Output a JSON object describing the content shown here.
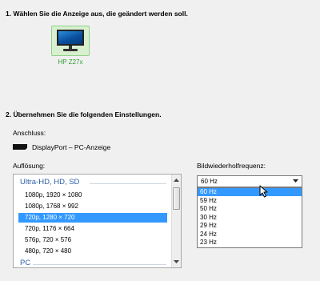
{
  "section1": {
    "heading": "1. Wählen Sie die Anzeige aus, die geändert werden soll."
  },
  "monitor": {
    "label": "HP Z27x",
    "icon": "monitor-icon"
  },
  "section2": {
    "heading": "2. Übernehmen Sie die folgenden Einstellungen."
  },
  "connection": {
    "label": "Anschluss:",
    "value": "DisplayPort – PC-Anzeige",
    "icon": "displayport-icon"
  },
  "resolution": {
    "label": "Auflösung:",
    "groups": [
      {
        "name": "Ultra-HD, HD, SD"
      },
      {
        "name": "PC"
      }
    ],
    "items": [
      "1080p, 1920 × 1080",
      "1080p, 1768 × 992",
      "720p, 1280 × 720",
      "720p, 1176 × 664",
      "576p, 720 × 576",
      "480p, 720 × 480"
    ],
    "selected_index": 2
  },
  "refresh": {
    "label": "Bildwiederholfrequenz:",
    "selected": "60 Hz",
    "options": [
      "60 Hz",
      "59 Hz",
      "50 Hz",
      "30 Hz",
      "29 Hz",
      "24 Hz",
      "23 Hz"
    ],
    "highlighted_index": 0
  },
  "colors": {
    "selection": "#3399ff",
    "group_header": "#2c5fa8",
    "monitor_label": "#2e9e2e",
    "monitor_tile": "#d8f0d0"
  }
}
